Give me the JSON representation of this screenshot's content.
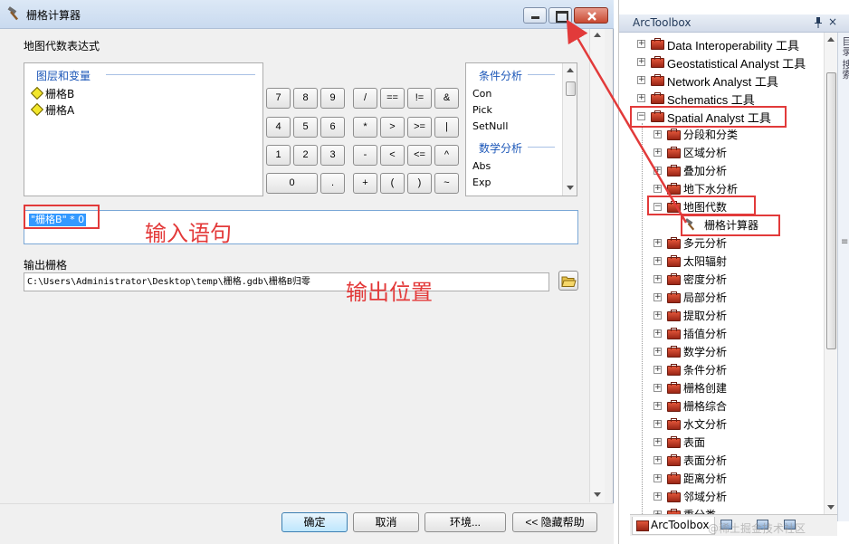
{
  "dialog": {
    "title": "栅格计算器",
    "expression_label": "地图代数表达式",
    "layers_title": "图层和变量",
    "layers": [
      "栅格B",
      "栅格A"
    ],
    "keypad": [
      "7",
      "8",
      "9",
      "/",
      "==",
      "!=",
      "&",
      "4",
      "5",
      "6",
      "*",
      ">",
      ">=",
      "|",
      "1",
      "2",
      "3",
      "-",
      "<",
      "<=",
      "^",
      "0",
      ".",
      "+",
      "(",
      ")",
      "~"
    ],
    "functions": {
      "groups": [
        {
          "title": "条件分析",
          "items": [
            "Con",
            "Pick",
            "SetNull"
          ]
        },
        {
          "title": "数学分析",
          "items": [
            "Abs",
            "Exp"
          ]
        }
      ]
    },
    "expression_value": "\"栅格B\" * 0",
    "output_label": "输出栅格",
    "output_value": "C:\\Users\\Administrator\\Desktop\\temp\\栅格.gdb\\栅格B归零",
    "buttons": {
      "ok": "确定",
      "cancel": "取消",
      "env": "环境...",
      "help": "<< 隐藏帮助"
    }
  },
  "annotations": {
    "input_statement": "输入语句",
    "output_location": "输出位置",
    "color": "#e23a3a"
  },
  "toolbox": {
    "title": "ArcToolbox",
    "pin_icon": "pin-icon",
    "close_glyph": "×",
    "side_tab_label": "目录 搜索",
    "top_items": [
      {
        "label": "Data Interoperability 工具"
      },
      {
        "label": "Geostatistical Analyst 工具"
      },
      {
        "label": "Network Analyst 工具"
      },
      {
        "label": "Schematics 工具"
      },
      {
        "label": "Spatial Analyst 工具"
      }
    ],
    "spatial_children": [
      {
        "label": "分段和分类"
      },
      {
        "label": "区域分析"
      },
      {
        "label": "叠加分析"
      },
      {
        "label": "地下水分析"
      },
      {
        "label": "地图代数",
        "expanded": true,
        "tool": "栅格计算器"
      },
      {
        "label": "多元分析"
      },
      {
        "label": "太阳辐射"
      },
      {
        "label": "密度分析"
      },
      {
        "label": "局部分析"
      },
      {
        "label": "提取分析"
      },
      {
        "label": "插值分析"
      },
      {
        "label": "数学分析"
      },
      {
        "label": "条件分析"
      },
      {
        "label": "栅格创建"
      },
      {
        "label": "栅格综合"
      },
      {
        "label": "水文分析"
      },
      {
        "label": "表面"
      },
      {
        "label": "表面分析"
      },
      {
        "label": "距离分析"
      },
      {
        "label": "邻域分析"
      },
      {
        "label": "重分类"
      }
    ],
    "tabs": {
      "toolbox": "ArcToolbox"
    },
    "watermark": "@稀土掘金技术社区"
  }
}
